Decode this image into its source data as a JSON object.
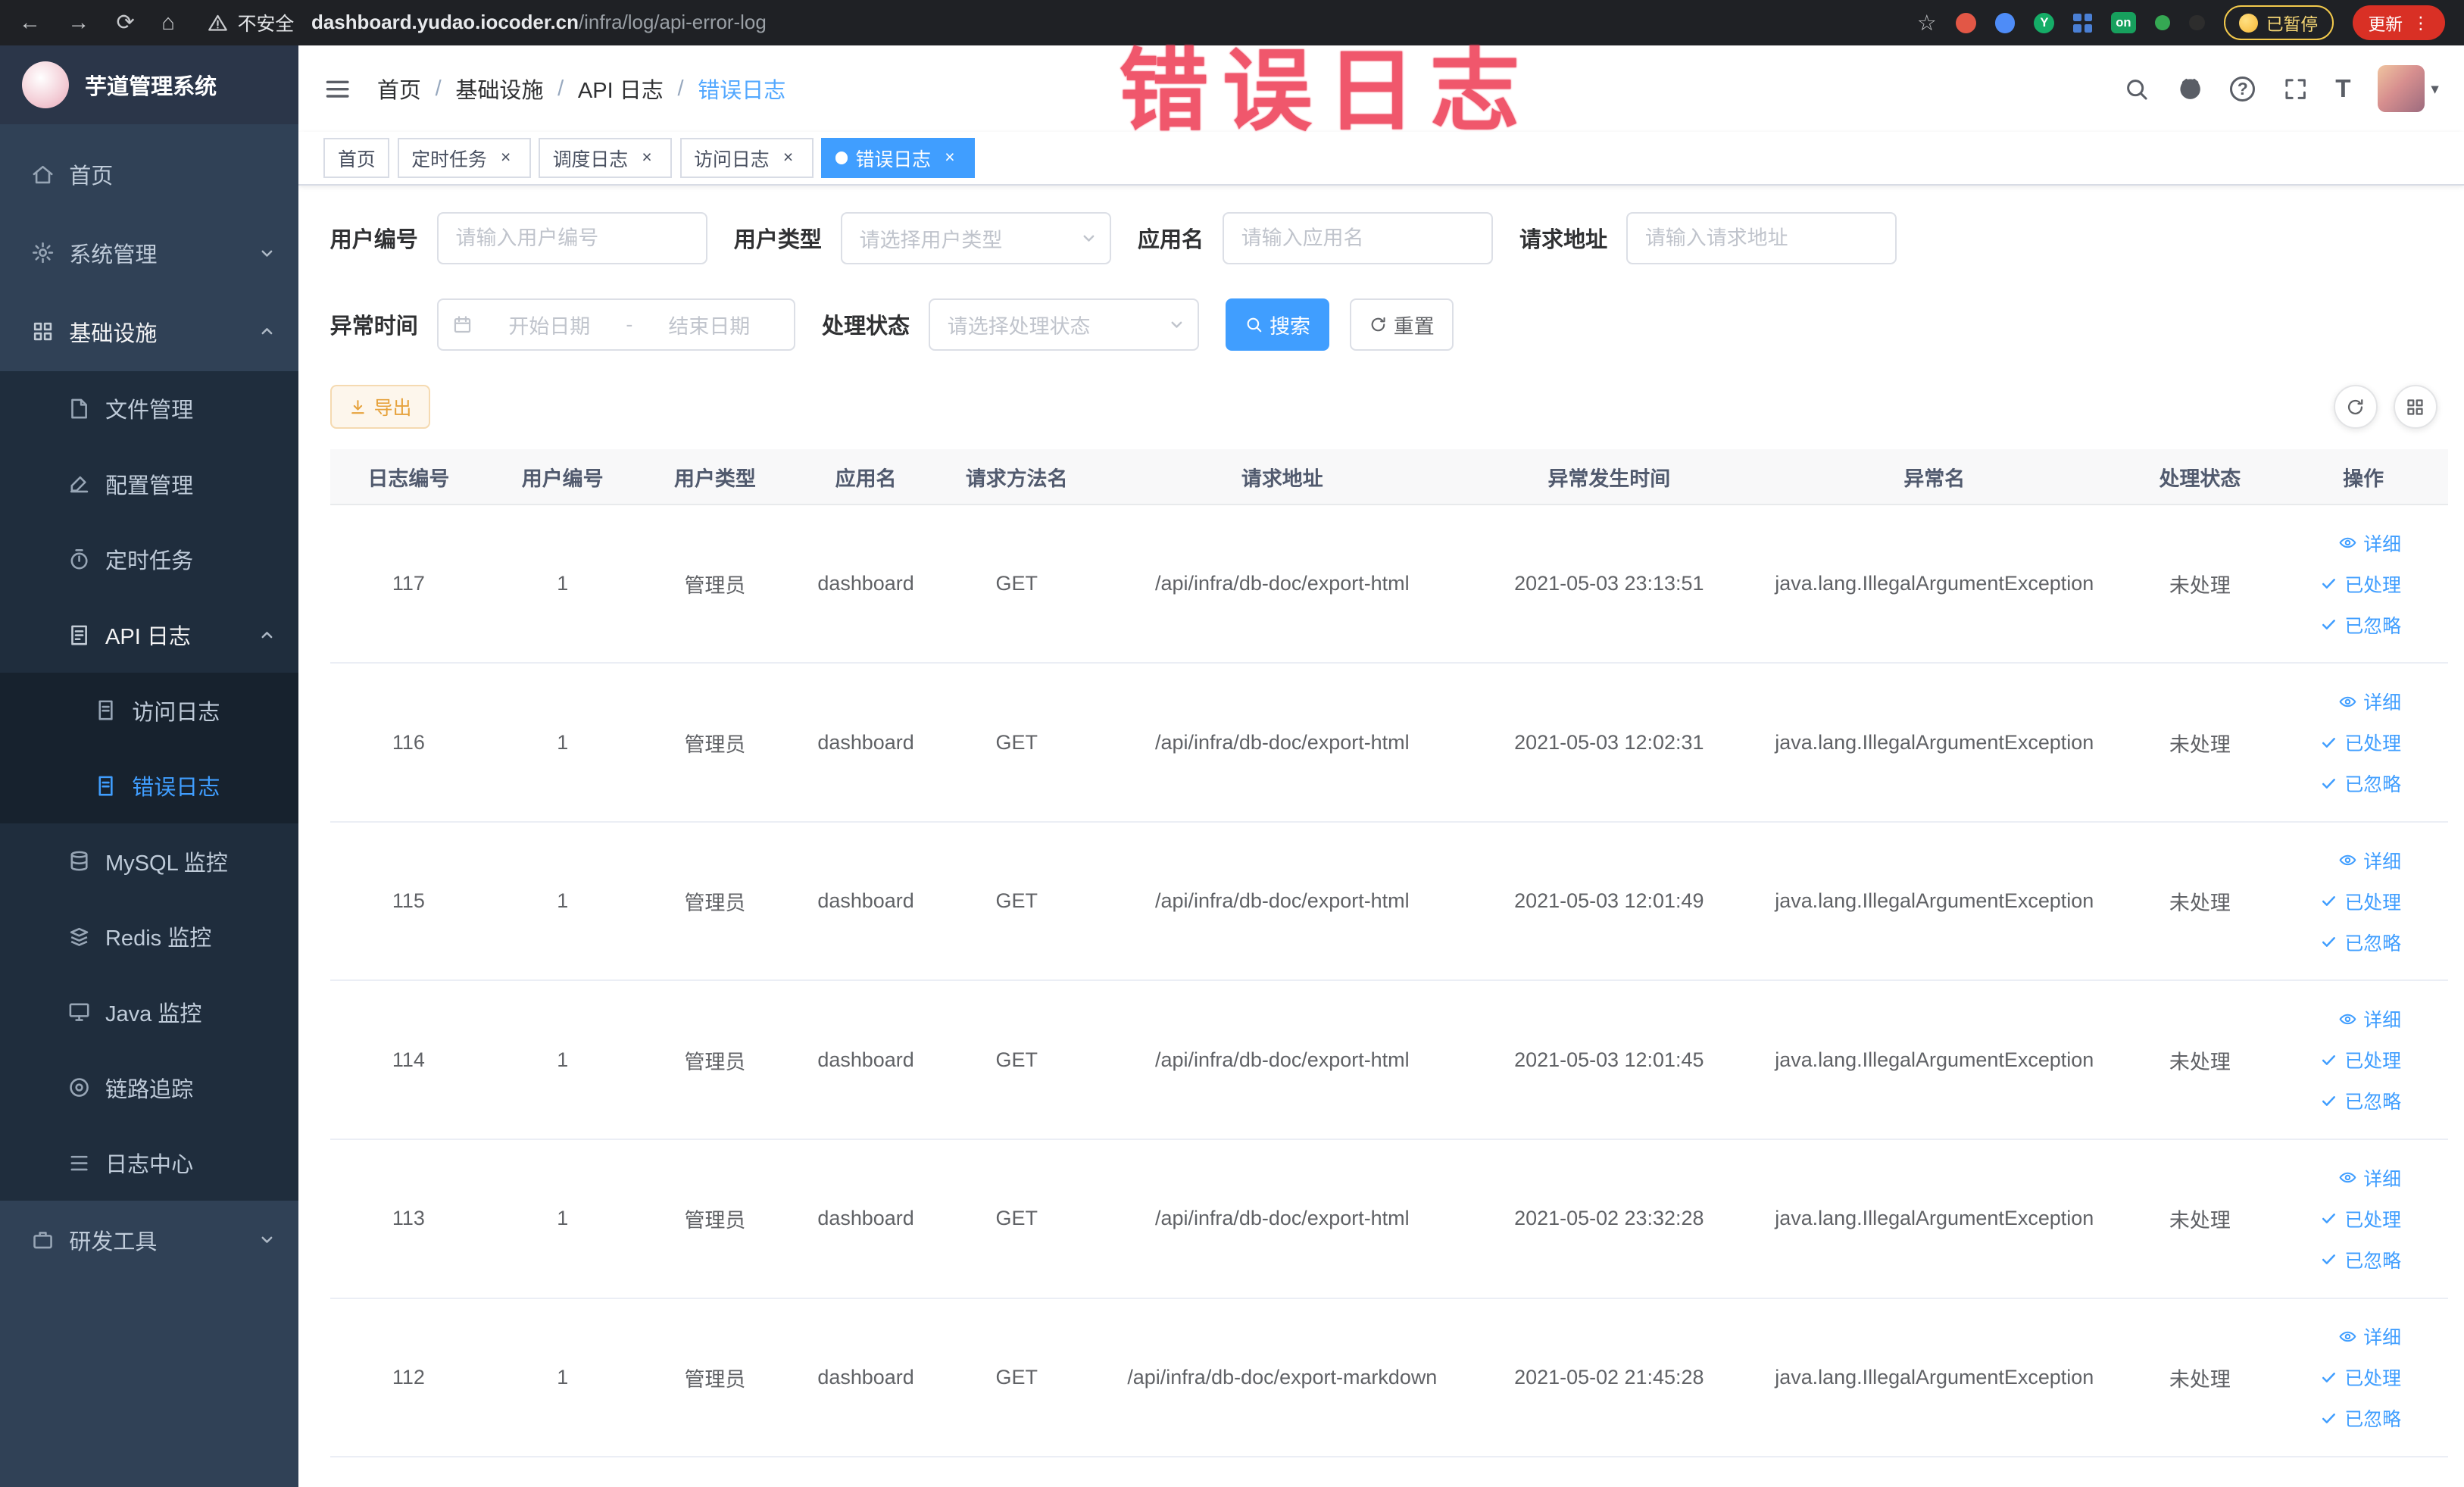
{
  "ui": {
    "close_glyph": "×",
    "caret_glyph": "▾",
    "star_glyph": "☆",
    "menu_glyph": "⋮",
    "help_glyph": "?",
    "fontsize_glyph": "T"
  },
  "colors": {
    "primary": "#409eff",
    "sidebar_bg": "#304156",
    "submenu_bg": "#1f2d3d",
    "warning": "#e6a23c",
    "overlay_red": "#ee4058"
  },
  "browser": {
    "nav": {
      "back": "←",
      "forward": "→",
      "reload": "⟳",
      "home": "⌂"
    },
    "security_label": "不安全",
    "url_domain": "dashboard.yudao.iocoder.cn",
    "url_path": "/infra/log/api-error-log",
    "extension_y_badge": "Y",
    "extension_on_badge": "on",
    "paused_badge": "已暂停",
    "update_button": "更新"
  },
  "overlay": {
    "text": "错误日志"
  },
  "sidebar": {
    "logo_title": "芋道管理系统",
    "items": [
      {
        "label": "首页",
        "icon": "home-icon"
      },
      {
        "label": "系统管理",
        "icon": "gear-icon",
        "state": "collapsed"
      },
      {
        "label": "基础设施",
        "icon": "grid-icon",
        "state": "expanded",
        "children": [
          {
            "label": "文件管理",
            "icon": "file-icon"
          },
          {
            "label": "配置管理",
            "icon": "edit-icon"
          },
          {
            "label": "定时任务",
            "icon": "timer-icon"
          },
          {
            "label": "API 日志",
            "icon": "api-log-icon",
            "state": "expanded",
            "children": [
              {
                "label": "访问日志",
                "icon": "doc-icon"
              },
              {
                "label": "错误日志",
                "icon": "doc-icon",
                "active": true
              }
            ]
          },
          {
            "label": "MySQL 监控",
            "icon": "database-icon"
          },
          {
            "label": "Redis 监控",
            "icon": "layers-icon"
          },
          {
            "label": "Java 监控",
            "icon": "monitor-icon"
          },
          {
            "label": "链路追踪",
            "icon": "target-icon"
          },
          {
            "label": "日志中心",
            "icon": "list-icon"
          }
        ]
      },
      {
        "label": "研发工具",
        "icon": "toolbox-icon",
        "state": "collapsed"
      }
    ]
  },
  "breadcrumb": {
    "separator": "/",
    "items": [
      "首页",
      "基础设施",
      "API 日志",
      "错误日志"
    ]
  },
  "tabs": [
    {
      "label": "首页",
      "closable": false,
      "active": false
    },
    {
      "label": "定时任务",
      "closable": true,
      "active": false
    },
    {
      "label": "调度日志",
      "closable": true,
      "active": false
    },
    {
      "label": "访问日志",
      "closable": true,
      "active": false
    },
    {
      "label": "错误日志",
      "closable": true,
      "active": true
    }
  ],
  "filters": {
    "user_id_label": "用户编号",
    "user_id_placeholder": "请输入用户编号",
    "user_type_label": "用户类型",
    "user_type_placeholder": "请选择用户类型",
    "app_name_label": "应用名",
    "app_name_placeholder": "请输入应用名",
    "request_url_label": "请求地址",
    "request_url_placeholder": "请输入请求地址",
    "exception_time_label": "异常时间",
    "start_date_placeholder": "开始日期",
    "range_separator": "-",
    "end_date_placeholder": "结束日期",
    "process_status_label": "处理状态",
    "process_status_placeholder": "请选择处理状态",
    "search_label": "搜索",
    "reset_label": "重置"
  },
  "toolbar": {
    "export_label": "导出"
  },
  "table": {
    "headers": [
      "日志编号",
      "用户编号",
      "用户类型",
      "应用名",
      "请求方法名",
      "请求地址",
      "异常发生时间",
      "异常名",
      "处理状态",
      "操作"
    ],
    "rows": [
      {
        "id": "117",
        "user_id": "1",
        "user_type": "管理员",
        "app_name": "dashboard",
        "method": "GET",
        "request_url": "/api/infra/db-doc/export-html",
        "exception_time": "2021-05-03 23:13:51",
        "exception_name": "java.lang.IllegalArgumentException",
        "status": "未处理"
      },
      {
        "id": "116",
        "user_id": "1",
        "user_type": "管理员",
        "app_name": "dashboard",
        "method": "GET",
        "request_url": "/api/infra/db-doc/export-html",
        "exception_time": "2021-05-03 12:02:31",
        "exception_name": "java.lang.IllegalArgumentException",
        "status": "未处理"
      },
      {
        "id": "115",
        "user_id": "1",
        "user_type": "管理员",
        "app_name": "dashboard",
        "method": "GET",
        "request_url": "/api/infra/db-doc/export-html",
        "exception_time": "2021-05-03 12:01:49",
        "exception_name": "java.lang.IllegalArgumentException",
        "status": "未处理"
      },
      {
        "id": "114",
        "user_id": "1",
        "user_type": "管理员",
        "app_name": "dashboard",
        "method": "GET",
        "request_url": "/api/infra/db-doc/export-html",
        "exception_time": "2021-05-03 12:01:45",
        "exception_name": "java.lang.IllegalArgumentException",
        "status": "未处理"
      },
      {
        "id": "113",
        "user_id": "1",
        "user_type": "管理员",
        "app_name": "dashboard",
        "method": "GET",
        "request_url": "/api/infra/db-doc/export-html",
        "exception_time": "2021-05-02 23:32:28",
        "exception_name": "java.lang.IllegalArgumentException",
        "status": "未处理"
      },
      {
        "id": "112",
        "user_id": "1",
        "user_type": "管理员",
        "app_name": "dashboard",
        "method": "GET",
        "request_url": "/api/infra/db-doc/export-markdown",
        "exception_time": "2021-05-02 21:45:28",
        "exception_name": "java.lang.IllegalArgumentException",
        "status": "未处理"
      }
    ],
    "actions": [
      {
        "label": "详细",
        "icon": "eye-icon"
      },
      {
        "label": "已处理",
        "icon": "check-icon"
      },
      {
        "label": "已忽略",
        "icon": "check-icon"
      }
    ]
  }
}
